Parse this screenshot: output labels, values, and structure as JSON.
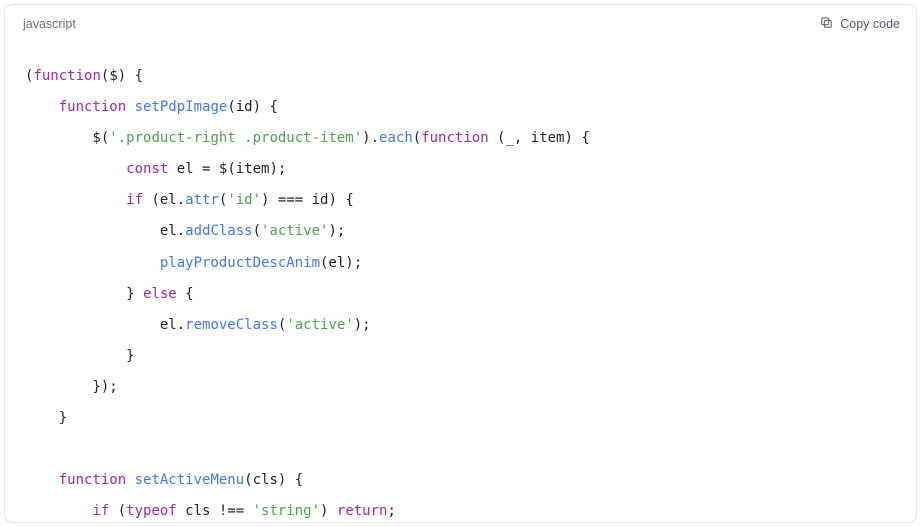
{
  "header": {
    "language_label": "javascript",
    "copy_label": "Copy code"
  },
  "code": {
    "tokens": [
      {
        "t": "(",
        "c": "c-punct"
      },
      {
        "t": "function",
        "c": "c-kw"
      },
      {
        "t": "(",
        "c": "c-punct"
      },
      {
        "t": "$",
        "c": "c-param"
      },
      {
        "t": ") {",
        "c": "c-punct"
      },
      {
        "nl": true
      },
      {
        "t": "    ",
        "c": "c-punct"
      },
      {
        "t": "function",
        "c": "c-kw"
      },
      {
        "t": " ",
        "c": "c-punct"
      },
      {
        "t": "setPdpImage",
        "c": "c-fn"
      },
      {
        "t": "(",
        "c": "c-punct"
      },
      {
        "t": "id",
        "c": "c-param"
      },
      {
        "t": ") {",
        "c": "c-punct"
      },
      {
        "nl": true
      },
      {
        "t": "        $(",
        "c": "c-punct"
      },
      {
        "t": "'.product-right .product-item'",
        "c": "c-str"
      },
      {
        "t": ").",
        "c": "c-punct"
      },
      {
        "t": "each",
        "c": "c-fncall"
      },
      {
        "t": "(",
        "c": "c-punct"
      },
      {
        "t": "function",
        "c": "c-kw"
      },
      {
        "t": " (",
        "c": "c-punct"
      },
      {
        "t": "_, item",
        "c": "c-param"
      },
      {
        "t": ") {",
        "c": "c-punct"
      },
      {
        "nl": true
      },
      {
        "t": "            ",
        "c": "c-punct"
      },
      {
        "t": "const",
        "c": "c-kw2"
      },
      {
        "t": " el = $(item);",
        "c": "c-ident"
      },
      {
        "nl": true
      },
      {
        "t": "            ",
        "c": "c-punct"
      },
      {
        "t": "if",
        "c": "c-kw2"
      },
      {
        "t": " (el.",
        "c": "c-ident"
      },
      {
        "t": "attr",
        "c": "c-fncall"
      },
      {
        "t": "(",
        "c": "c-punct"
      },
      {
        "t": "'id'",
        "c": "c-str"
      },
      {
        "t": ") === id) {",
        "c": "c-ident"
      },
      {
        "nl": true
      },
      {
        "t": "                el.",
        "c": "c-ident"
      },
      {
        "t": "addClass",
        "c": "c-fncall"
      },
      {
        "t": "(",
        "c": "c-punct"
      },
      {
        "t": "'active'",
        "c": "c-str"
      },
      {
        "t": ");",
        "c": "c-punct"
      },
      {
        "nl": true
      },
      {
        "t": "                ",
        "c": "c-punct"
      },
      {
        "t": "playProductDescAnim",
        "c": "c-fncall"
      },
      {
        "t": "(el);",
        "c": "c-ident"
      },
      {
        "nl": true
      },
      {
        "t": "            } ",
        "c": "c-punct"
      },
      {
        "t": "else",
        "c": "c-kw2"
      },
      {
        "t": " {",
        "c": "c-punct"
      },
      {
        "nl": true
      },
      {
        "t": "                el.",
        "c": "c-ident"
      },
      {
        "t": "removeClass",
        "c": "c-fncall"
      },
      {
        "t": "(",
        "c": "c-punct"
      },
      {
        "t": "'active'",
        "c": "c-str"
      },
      {
        "t": ");",
        "c": "c-punct"
      },
      {
        "nl": true
      },
      {
        "t": "            }",
        "c": "c-punct"
      },
      {
        "nl": true
      },
      {
        "t": "        });",
        "c": "c-punct"
      },
      {
        "nl": true
      },
      {
        "t": "    }",
        "c": "c-punct"
      },
      {
        "nl": true
      },
      {
        "nl": true
      },
      {
        "t": "    ",
        "c": "c-punct"
      },
      {
        "t": "function",
        "c": "c-kw"
      },
      {
        "t": " ",
        "c": "c-punct"
      },
      {
        "t": "setActiveMenu",
        "c": "c-fn"
      },
      {
        "t": "(",
        "c": "c-punct"
      },
      {
        "t": "cls",
        "c": "c-param"
      },
      {
        "t": ") {",
        "c": "c-punct"
      },
      {
        "nl": true
      },
      {
        "t": "        ",
        "c": "c-punct"
      },
      {
        "t": "if",
        "c": "c-kw2"
      },
      {
        "t": " (",
        "c": "c-punct"
      },
      {
        "t": "typeof",
        "c": "c-kw2"
      },
      {
        "t": " cls !== ",
        "c": "c-ident"
      },
      {
        "t": "'string'",
        "c": "c-str"
      },
      {
        "t": ") ",
        "c": "c-punct"
      },
      {
        "t": "return",
        "c": "c-kw2"
      },
      {
        "t": ";",
        "c": "c-punct"
      }
    ]
  }
}
